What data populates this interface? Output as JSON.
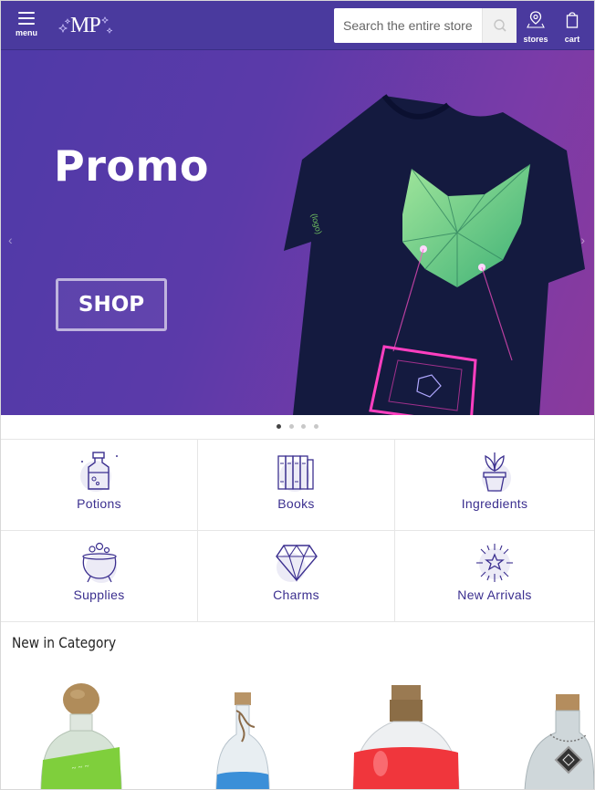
{
  "header": {
    "menu_label": "menu",
    "logo_text": "MP",
    "search_placeholder": "Search the entire store",
    "stores_label": "stores",
    "cart_label": "cart",
    "background_color": "#4a3a9e"
  },
  "hero": {
    "title": "Promo",
    "button_label": "SHOP",
    "prev_arrow": "‹",
    "next_arrow": "›",
    "slide_count": 4,
    "active_slide": 1
  },
  "categories": [
    {
      "label": "Potions",
      "icon": "potion-bottle-icon"
    },
    {
      "label": "Books",
      "icon": "books-icon"
    },
    {
      "label": "Ingredients",
      "icon": "potted-plant-icon"
    },
    {
      "label": "Supplies",
      "icon": "cauldron-icon"
    },
    {
      "label": "Charms",
      "icon": "diamond-icon"
    },
    {
      "label": "New Arrivals",
      "icon": "sparkle-burst-icon"
    }
  ],
  "new_in_category": {
    "title": "New in Category",
    "products": [
      {
        "image": "green-cork-bottle-image"
      },
      {
        "image": "blue-tied-vial-image"
      },
      {
        "image": "red-round-flask-image"
      },
      {
        "image": "pendant-bottle-image"
      }
    ]
  },
  "colors": {
    "brand": "#4a3a9e",
    "accent_text": "#3b2f8f"
  }
}
